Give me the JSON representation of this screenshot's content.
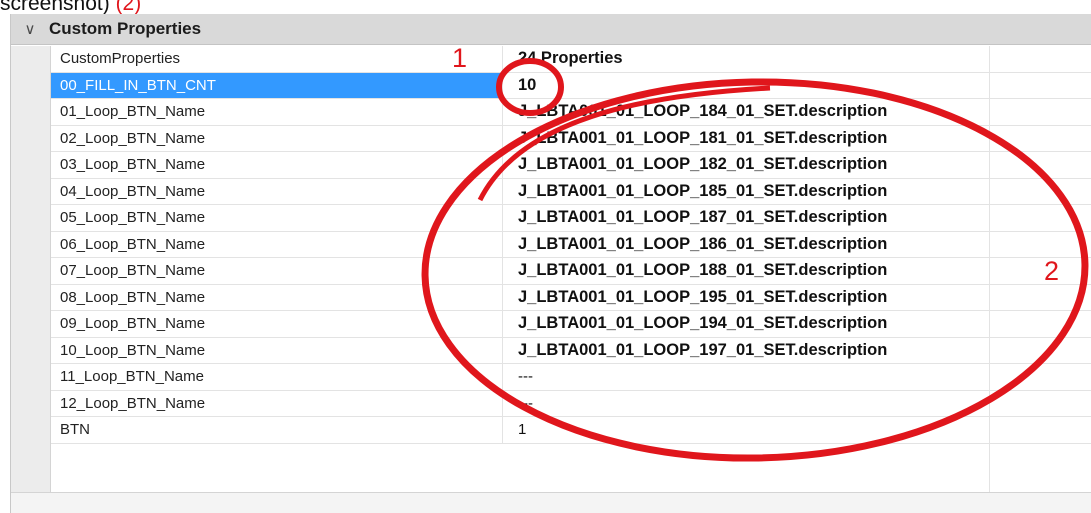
{
  "caption": {
    "text": "screenshot)",
    "num": "(2)"
  },
  "group": {
    "chevron_icon": "chevron-down-icon",
    "title": "Custom Properties"
  },
  "rows": [
    {
      "name": "CustomProperties",
      "value": "24 Properties",
      "bold": true
    },
    {
      "name": "00_FILL_IN_BTN_CNT",
      "value": "10",
      "bold": true,
      "selected": true
    },
    {
      "name": "01_Loop_BTN_Name",
      "value": "J_LBTA001_01_LOOP_184_01_SET.description",
      "bold": true
    },
    {
      "name": "02_Loop_BTN_Name",
      "value": "J_LBTA001_01_LOOP_181_01_SET.description",
      "bold": true
    },
    {
      "name": "03_Loop_BTN_Name",
      "value": "J_LBTA001_01_LOOP_182_01_SET.description",
      "bold": true
    },
    {
      "name": "04_Loop_BTN_Name",
      "value": "J_LBTA001_01_LOOP_185_01_SET.description",
      "bold": true
    },
    {
      "name": "05_Loop_BTN_Name",
      "value": "J_LBTA001_01_LOOP_187_01_SET.description",
      "bold": true
    },
    {
      "name": "06_Loop_BTN_Name",
      "value": "J_LBTA001_01_LOOP_186_01_SET.description",
      "bold": true
    },
    {
      "name": "07_Loop_BTN_Name",
      "value": "J_LBTA001_01_LOOP_188_01_SET.description",
      "bold": true
    },
    {
      "name": "08_Loop_BTN_Name",
      "value": "J_LBTA001_01_LOOP_195_01_SET.description",
      "bold": true
    },
    {
      "name": "09_Loop_BTN_Name",
      "value": "J_LBTA001_01_LOOP_194_01_SET.description",
      "bold": true
    },
    {
      "name": "10_Loop_BTN_Name",
      "value": "J_LBTA001_01_LOOP_197_01_SET.description",
      "bold": true
    },
    {
      "name": "11_Loop_BTN_Name",
      "value": "---",
      "bold": false
    },
    {
      "name": "12_Loop_BTN_Name",
      "value": "---",
      "bold": false
    },
    {
      "name": "BTN",
      "value": "1",
      "bold": false
    }
  ],
  "annotations": {
    "label_1": "1",
    "label_2": "2",
    "color": "#e0161c"
  },
  "colors": {
    "selection": "#3399ff",
    "group_header": "#d9d9d9"
  }
}
